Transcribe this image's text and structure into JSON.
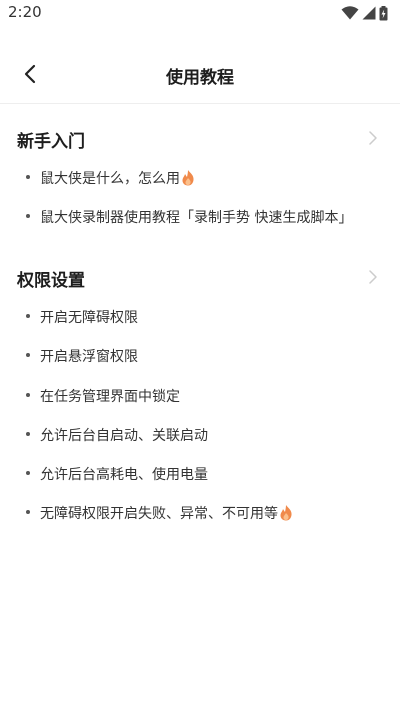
{
  "status_bar": {
    "time": "2:20",
    "icons": [
      "wifi-icon",
      "signal-icon",
      "battery-icon"
    ]
  },
  "nav": {
    "title": "使用教程",
    "back_icon": "chevron-left-icon"
  },
  "sections": [
    {
      "title": "新手入门",
      "items": [
        {
          "label": "鼠大侠是什么，怎么用",
          "icon": "fire-icon"
        },
        {
          "label": "鼠大侠录制器使用教程「录制手势 快速生成脚本」"
        }
      ]
    },
    {
      "title": "权限设置",
      "items": [
        {
          "label": "开启无障碍权限"
        },
        {
          "label": "开启悬浮窗权限"
        },
        {
          "label": "在任务管理界面中锁定"
        },
        {
          "label": "允许后台自启动、关联启动"
        },
        {
          "label": "允许后台高耗电、使用电量"
        },
        {
          "label": "无障碍权限开启失败、异常、不可用等",
          "icon": "fire-icon"
        }
      ]
    }
  ],
  "colors": {
    "text_primary": "#1e1e1e",
    "text_item": "#333333",
    "chevron": "#cccccc",
    "fire": "#f08a4b",
    "divider": "#eeeeee"
  }
}
